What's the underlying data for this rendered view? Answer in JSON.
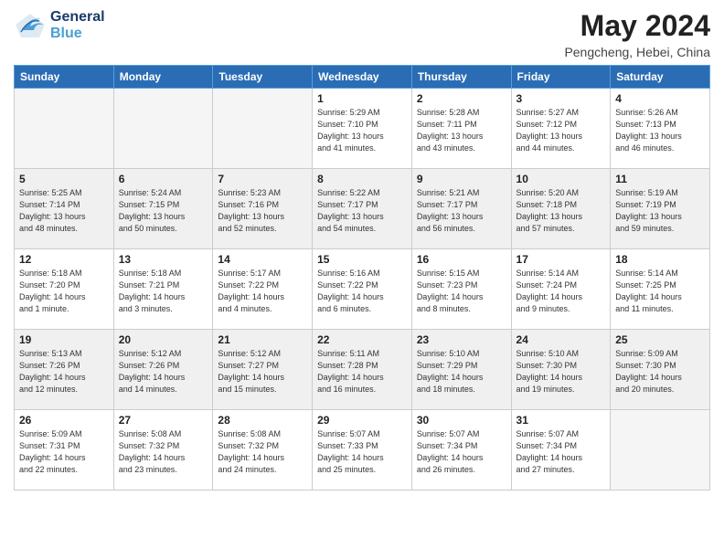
{
  "header": {
    "logo_general": "General",
    "logo_blue": "Blue",
    "title": "May 2024",
    "subtitle": "Pengcheng, Hebei, China"
  },
  "days_of_week": [
    "Sunday",
    "Monday",
    "Tuesday",
    "Wednesday",
    "Thursday",
    "Friday",
    "Saturday"
  ],
  "weeks": [
    [
      {
        "num": "",
        "info": ""
      },
      {
        "num": "",
        "info": ""
      },
      {
        "num": "",
        "info": ""
      },
      {
        "num": "1",
        "info": "Sunrise: 5:29 AM\nSunset: 7:10 PM\nDaylight: 13 hours\nand 41 minutes."
      },
      {
        "num": "2",
        "info": "Sunrise: 5:28 AM\nSunset: 7:11 PM\nDaylight: 13 hours\nand 43 minutes."
      },
      {
        "num": "3",
        "info": "Sunrise: 5:27 AM\nSunset: 7:12 PM\nDaylight: 13 hours\nand 44 minutes."
      },
      {
        "num": "4",
        "info": "Sunrise: 5:26 AM\nSunset: 7:13 PM\nDaylight: 13 hours\nand 46 minutes."
      }
    ],
    [
      {
        "num": "5",
        "info": "Sunrise: 5:25 AM\nSunset: 7:14 PM\nDaylight: 13 hours\nand 48 minutes."
      },
      {
        "num": "6",
        "info": "Sunrise: 5:24 AM\nSunset: 7:15 PM\nDaylight: 13 hours\nand 50 minutes."
      },
      {
        "num": "7",
        "info": "Sunrise: 5:23 AM\nSunset: 7:16 PM\nDaylight: 13 hours\nand 52 minutes."
      },
      {
        "num": "8",
        "info": "Sunrise: 5:22 AM\nSunset: 7:17 PM\nDaylight: 13 hours\nand 54 minutes."
      },
      {
        "num": "9",
        "info": "Sunrise: 5:21 AM\nSunset: 7:17 PM\nDaylight: 13 hours\nand 56 minutes."
      },
      {
        "num": "10",
        "info": "Sunrise: 5:20 AM\nSunset: 7:18 PM\nDaylight: 13 hours\nand 57 minutes."
      },
      {
        "num": "11",
        "info": "Sunrise: 5:19 AM\nSunset: 7:19 PM\nDaylight: 13 hours\nand 59 minutes."
      }
    ],
    [
      {
        "num": "12",
        "info": "Sunrise: 5:18 AM\nSunset: 7:20 PM\nDaylight: 14 hours\nand 1 minute."
      },
      {
        "num": "13",
        "info": "Sunrise: 5:18 AM\nSunset: 7:21 PM\nDaylight: 14 hours\nand 3 minutes."
      },
      {
        "num": "14",
        "info": "Sunrise: 5:17 AM\nSunset: 7:22 PM\nDaylight: 14 hours\nand 4 minutes."
      },
      {
        "num": "15",
        "info": "Sunrise: 5:16 AM\nSunset: 7:22 PM\nDaylight: 14 hours\nand 6 minutes."
      },
      {
        "num": "16",
        "info": "Sunrise: 5:15 AM\nSunset: 7:23 PM\nDaylight: 14 hours\nand 8 minutes."
      },
      {
        "num": "17",
        "info": "Sunrise: 5:14 AM\nSunset: 7:24 PM\nDaylight: 14 hours\nand 9 minutes."
      },
      {
        "num": "18",
        "info": "Sunrise: 5:14 AM\nSunset: 7:25 PM\nDaylight: 14 hours\nand 11 minutes."
      }
    ],
    [
      {
        "num": "19",
        "info": "Sunrise: 5:13 AM\nSunset: 7:26 PM\nDaylight: 14 hours\nand 12 minutes."
      },
      {
        "num": "20",
        "info": "Sunrise: 5:12 AM\nSunset: 7:26 PM\nDaylight: 14 hours\nand 14 minutes."
      },
      {
        "num": "21",
        "info": "Sunrise: 5:12 AM\nSunset: 7:27 PM\nDaylight: 14 hours\nand 15 minutes."
      },
      {
        "num": "22",
        "info": "Sunrise: 5:11 AM\nSunset: 7:28 PM\nDaylight: 14 hours\nand 16 minutes."
      },
      {
        "num": "23",
        "info": "Sunrise: 5:10 AM\nSunset: 7:29 PM\nDaylight: 14 hours\nand 18 minutes."
      },
      {
        "num": "24",
        "info": "Sunrise: 5:10 AM\nSunset: 7:30 PM\nDaylight: 14 hours\nand 19 minutes."
      },
      {
        "num": "25",
        "info": "Sunrise: 5:09 AM\nSunset: 7:30 PM\nDaylight: 14 hours\nand 20 minutes."
      }
    ],
    [
      {
        "num": "26",
        "info": "Sunrise: 5:09 AM\nSunset: 7:31 PM\nDaylight: 14 hours\nand 22 minutes."
      },
      {
        "num": "27",
        "info": "Sunrise: 5:08 AM\nSunset: 7:32 PM\nDaylight: 14 hours\nand 23 minutes."
      },
      {
        "num": "28",
        "info": "Sunrise: 5:08 AM\nSunset: 7:32 PM\nDaylight: 14 hours\nand 24 minutes."
      },
      {
        "num": "29",
        "info": "Sunrise: 5:07 AM\nSunset: 7:33 PM\nDaylight: 14 hours\nand 25 minutes."
      },
      {
        "num": "30",
        "info": "Sunrise: 5:07 AM\nSunset: 7:34 PM\nDaylight: 14 hours\nand 26 minutes."
      },
      {
        "num": "31",
        "info": "Sunrise: 5:07 AM\nSunset: 7:34 PM\nDaylight: 14 hours\nand 27 minutes."
      },
      {
        "num": "",
        "info": ""
      }
    ]
  ]
}
